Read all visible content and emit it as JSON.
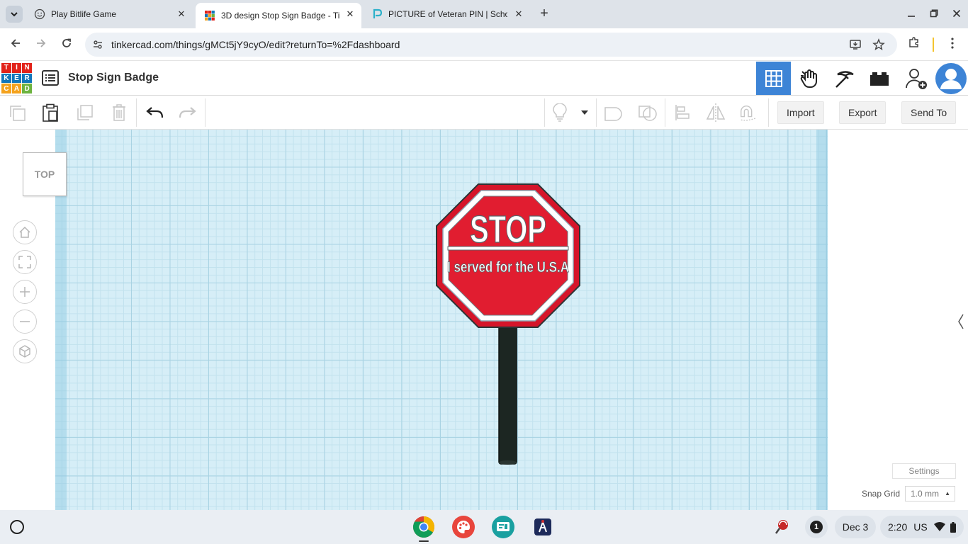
{
  "browser": {
    "tabs": [
      {
        "title": "Play Bitlife Game",
        "active": false
      },
      {
        "title": "3D design Stop Sign Badge - Ti",
        "active": true
      },
      {
        "title": "PICTURE of Veteran PIN | Scho",
        "active": false
      }
    ],
    "url": "tinkercad.com/things/gMCt5jY9cyO/edit?returnTo=%2Fdashboard",
    "close_glyph": "✕",
    "newtab_glyph": "+"
  },
  "tinkercad": {
    "logo_letters": [
      "T",
      "I",
      "N",
      "K",
      "E",
      "R",
      "C",
      "A",
      "D"
    ],
    "logo_colors": [
      "#e2231a",
      "#e2231a",
      "#e2231a",
      "#1277bc",
      "#1277bc",
      "#1277bc",
      "#f4a21d",
      "#f4a21d",
      "#6db33f"
    ],
    "design_title": "Stop Sign Badge",
    "toolbar": {
      "import_label": "Import",
      "export_label": "Export",
      "send_to_label": "Send To"
    },
    "viewcube_label": "TOP",
    "stop_sign": {
      "main_text": "STOP",
      "sub_text": "I served for the U.S.A",
      "fill_color": "#e11d30",
      "post_color": "#1c2622"
    },
    "settings_label": "Settings",
    "snap_grid_label": "Snap Grid",
    "snap_grid_value": "1.0 mm",
    "accent_color": "#3d84d6"
  },
  "shelf": {
    "notification_count": "1",
    "date": "Dec 3",
    "time": "2:20",
    "locale": "US"
  }
}
